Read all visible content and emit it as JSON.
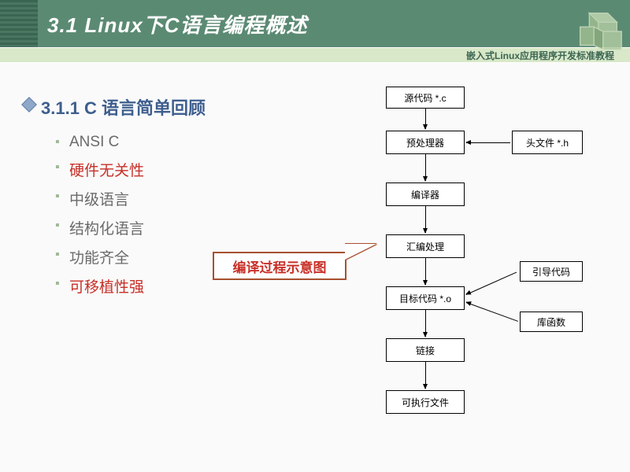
{
  "header": {
    "title": "3.1 Linux下C语言编程概述",
    "subtitle": "嵌入式Linux应用程序开发标准教程"
  },
  "main": {
    "heading": "3.1.1 C 语言简单回顾",
    "bullets": [
      {
        "text": "ANSI C",
        "red": false
      },
      {
        "text": "硬件无关性",
        "red": true
      },
      {
        "text": "中级语言",
        "red": false
      },
      {
        "text": "结构化语言",
        "red": false
      },
      {
        "text": "功能齐全",
        "red": false
      },
      {
        "text": "可移植性强",
        "red": true
      }
    ],
    "callout": "编译过程示意图"
  },
  "flow": {
    "n1": "源代码 *.c",
    "n2": "预处理器",
    "n3": "编译器",
    "n4": "汇编处理",
    "n5": "目标代码 *.o",
    "n6": "链接",
    "n7": "可执行文件",
    "s1": "头文件 *.h",
    "s2": "引导代码",
    "s3": "库函数"
  }
}
